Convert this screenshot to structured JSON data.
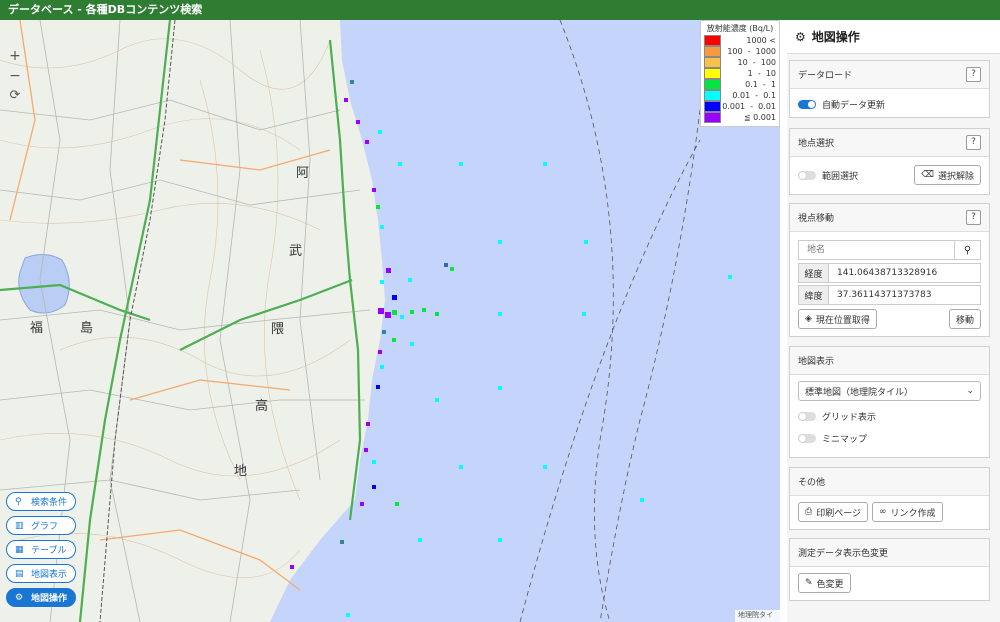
{
  "app": {
    "title": "データベース - 各種DBコンテンツ検索"
  },
  "map": {
    "zoom_in": "+",
    "zoom_out": "−",
    "attribution": "地理院タイル",
    "place_labels": {
      "fukushima": "福",
      "shima": "島",
      "a": "阿",
      "bu": "武",
      "kuma": "隈",
      "kou": "高",
      "chi": "地"
    },
    "ocean_color": "#c4d4fb",
    "land_color": "#eef0ea"
  },
  "legend": {
    "title": "放射能濃度 (Bq/L)",
    "rows": [
      {
        "color": "#ff0000",
        "label": "1000 <"
      },
      {
        "color": "#f59a3f",
        "label": "100  -  1000"
      },
      {
        "color": "#f8c14a",
        "label": "10  -  100"
      },
      {
        "color": "#ffff00",
        "label": "1  -  10"
      },
      {
        "color": "#00e640",
        "label": "0.1  -  1"
      },
      {
        "color": "#00ffff",
        "label": "0.01  -  0.1"
      },
      {
        "color": "#0000ff",
        "label": "0.001  -  0.01"
      },
      {
        "color": "#9900ff",
        "label": "≦ 0.001"
      }
    ]
  },
  "left_buttons": [
    {
      "label": "検索条件",
      "icon": "search-icon"
    },
    {
      "label": "グラフ",
      "icon": "chart-icon"
    },
    {
      "label": "テーブル",
      "icon": "table-icon"
    },
    {
      "label": "地図表示",
      "icon": "map-icon"
    },
    {
      "label": "地図操作",
      "icon": "gear-icon",
      "active": true
    }
  ],
  "panel": {
    "title": "地図操作",
    "data_load": {
      "title": "データロード",
      "help": "?",
      "auto_update": "自動データ更新"
    },
    "point_select": {
      "title": "地点選択",
      "help": "?",
      "range_select": "範囲選択",
      "clear": "選択解除"
    },
    "viewpoint": {
      "title": "視点移動",
      "help": "?",
      "placename_placeholder": "地名",
      "lon_label": "経度",
      "lon_value": "141.06438713328916",
      "lat_label": "緯度",
      "lat_value": "37.36114371373783",
      "current_pos": "現在位置取得",
      "move": "移動"
    },
    "map_display": {
      "title": "地図表示",
      "tile_selected": "標準地図（地理院タイル）",
      "grid": "グリッド表示",
      "minimap": "ミニマップ"
    },
    "other": {
      "title": "その他",
      "print": "印刷ページ",
      "link": "リンク作成"
    },
    "color_change": {
      "title": "測定データ表示色変更",
      "button": "色変更"
    }
  }
}
